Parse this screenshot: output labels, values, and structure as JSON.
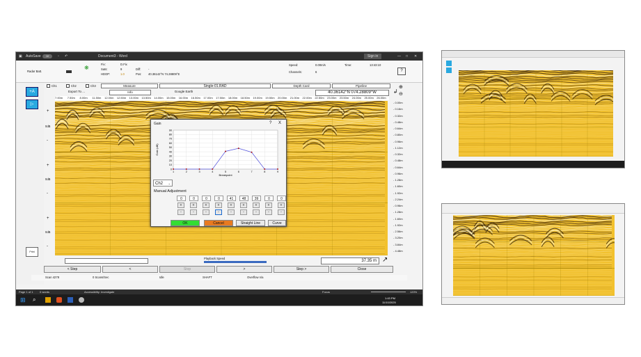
{
  "word": {
    "autosave": "AutoSave",
    "autosave_state": "Off",
    "doc_title": "Document3 - Word",
    "sign_in": "Sign in"
  },
  "info": {
    "radar_batt_label": "Radar Batt.",
    "fix_label": "Fix:",
    "fix_value": "D.Fix",
    "sats_label": "Sats:",
    "sats_value": "9",
    "diff_label": "Diff:",
    "diff_value": "-",
    "hdop_label": "HDOP:",
    "hdop_value": "1.0",
    "pos_label": "Pos:",
    "pos_value": "40.36142°N 74.28809°E",
    "speed_label": "Speed:",
    "speed_value": "0.00m/s",
    "channels_label": "Channels:",
    "channels_value": "6",
    "time_label": "Time:",
    "time_value": "13:43:10"
  },
  "channels": {
    "ch1": "Ch1",
    "ch2": "Ch2",
    "ch3": "Ch3",
    "measure": "Measure",
    "file_name": "Single-01.RAD",
    "depth_card": "Depth Card",
    "pipeline": "Pipeline"
  },
  "export": {
    "export_to": "Export To ...",
    "info": "Info",
    "google_earth": "Google Earth",
    "coords": "40.36142°N 074.28809°W"
  },
  "distance_ticks": [
    "7.00m",
    "7.50m",
    "8.00m",
    "11.50m",
    "12.00m",
    "12.50m",
    "13.00m",
    "13.50m",
    "14.00m",
    "15.00m",
    "16.00m",
    "16.50m",
    "17.00m",
    "17.50m",
    "18.00m",
    "18.50m",
    "19.00m",
    "19.50m",
    "20.00m",
    "21.00m",
    "22.00m",
    "22.50m",
    "23.00m",
    "23.50m",
    "24.00m",
    "25.00m",
    "26.00m"
  ],
  "depth_ticks": [
    "0.00m",
    "0.16m",
    "0.32m",
    "0.48m",
    "0.64m",
    "0.80m",
    "0.96m",
    "1.12m",
    "0.32m",
    "0.48m",
    "0.64m",
    "0.96m",
    "1.28m",
    "1.60m",
    "1.92m",
    "2.24m",
    "0.96m",
    "1.28m",
    "1.60m",
    "1.92m",
    "2.56m",
    "3.20m",
    "3.84m",
    "4.48m"
  ],
  "gain_labels": [
    "0dB",
    "0dB",
    "0dB"
  ],
  "gain_dialog": {
    "title": "Gain",
    "help": "?",
    "close": "X",
    "y_axis_label": "Gain (dB)",
    "x_axis_label": "Breakpoint",
    "channel": "Ch2",
    "manual_adjustment": "Manual Adjustment",
    "values": [
      "0",
      "0",
      "0",
      "0",
      "41",
      "48",
      "39",
      "0",
      "0"
    ],
    "ok": "OK",
    "cancel": "Cancel",
    "straight_line": "Straight Line",
    "curve": "Curve"
  },
  "chart_data": {
    "type": "line",
    "xlabel": "Breakpoint",
    "ylabel": "Gain (dB)",
    "x": [
      1,
      2,
      3,
      4,
      5,
      6,
      7,
      8,
      9
    ],
    "values": [
      0,
      0,
      0,
      0,
      41,
      48,
      39,
      0,
      0
    ],
    "ylim": [
      0,
      90
    ],
    "yticks": [
      0,
      10,
      20,
      30,
      40,
      50,
      60,
      70,
      80,
      90
    ],
    "grid": true
  },
  "bottom": {
    "playback_speed": "Playback Speed",
    "distance": "37.35 m",
    "step_back": "< Step",
    "prev": "<",
    "stop": "Stop",
    "next": ">",
    "step_fwd": "Step >",
    "close": "Close",
    "scan": "Scan 4278",
    "scan_rate": "0 Scans/Sec",
    "idle": "Idle",
    "shaft": "SHAFT",
    "overflow": "Overflow n/a",
    "print": "Print"
  },
  "status": {
    "page": "Page 1 of 1",
    "words": "0 words",
    "accessibility": "Accessibility: Investigate",
    "focus": "Focus",
    "zoom": "120%"
  },
  "taskbar": {
    "time": "1:43 PM",
    "date": "11/10/2025"
  },
  "colors": {
    "radar_bg": "#f2c12e",
    "ok_green": "#33dd33",
    "cancel_orange": "#e87a20",
    "curve_line": "#5555dd",
    "curve_point": "#aa1111"
  }
}
